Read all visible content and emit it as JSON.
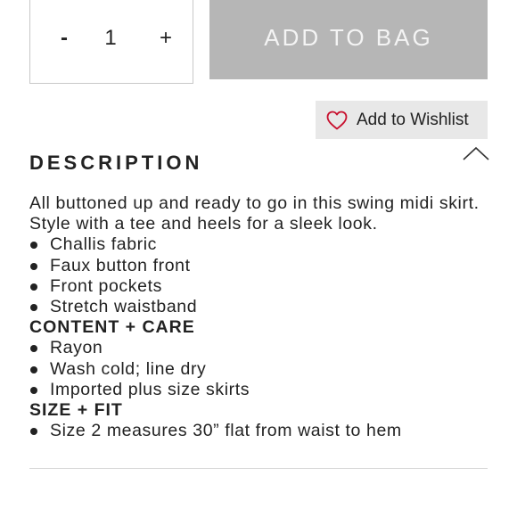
{
  "quantity": {
    "minus_label": "-",
    "value": "1",
    "plus_label": "+"
  },
  "add_to_bag": {
    "label": "ADD TO BAG"
  },
  "wishlist": {
    "label": "Add to Wishlist",
    "icon": "heart-outline-icon",
    "icon_color": "#c8102e"
  },
  "collapse": {
    "icon": "chevron-up-icon"
  },
  "description": {
    "heading": "DESCRIPTION",
    "intro": "All buttoned up and ready to go in this swing midi skirt. Style with a tee and heels for a sleek look.",
    "features": [
      "Challis fabric",
      "Faux button front",
      "Front pockets",
      "Stretch waistband"
    ],
    "content_care_heading": "CONTENT + CARE",
    "content_care": [
      "Rayon",
      "Wash cold; line dry",
      "Imported plus size skirts"
    ],
    "size_fit_heading": "SIZE + FIT",
    "size_fit": [
      "Size 2 measures 30” flat from waist to hem"
    ]
  },
  "colors": {
    "button_bg": "#b6b6b6",
    "button_text": "#f4f4f4",
    "wishlist_bg": "#e8e8e8",
    "text": "#222222"
  }
}
